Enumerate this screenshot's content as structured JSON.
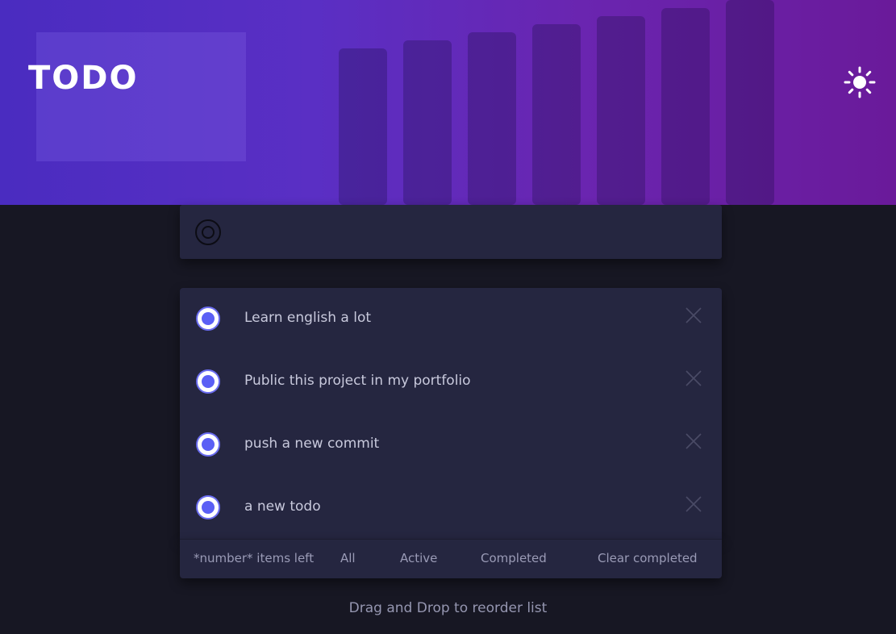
{
  "header": {
    "title": "TODO",
    "theme_icon": "sun-icon"
  },
  "new_todo": {
    "placeholder": "",
    "value": ""
  },
  "todos": [
    {
      "text": "Learn english a lot",
      "completed": true
    },
    {
      "text": "Public this project in my portfolio",
      "completed": true
    },
    {
      "text": "push a new commit",
      "completed": true
    },
    {
      "text": "a new todo",
      "completed": true
    }
  ],
  "footer": {
    "items_left": "*number* items left",
    "filters": {
      "all": "All",
      "active": "Active",
      "completed": "Completed"
    },
    "clear_completed": "Clear completed"
  },
  "hint": "Drag and Drop to reorder list",
  "colors": {
    "background": "#171723",
    "card": "#252640",
    "accent": "#5b5ff5",
    "text": "#c8c9dc",
    "muted": "#9a9bb6",
    "header_gradient_start": "#4a2cc0",
    "header_gradient_end": "#6a1a9a"
  }
}
